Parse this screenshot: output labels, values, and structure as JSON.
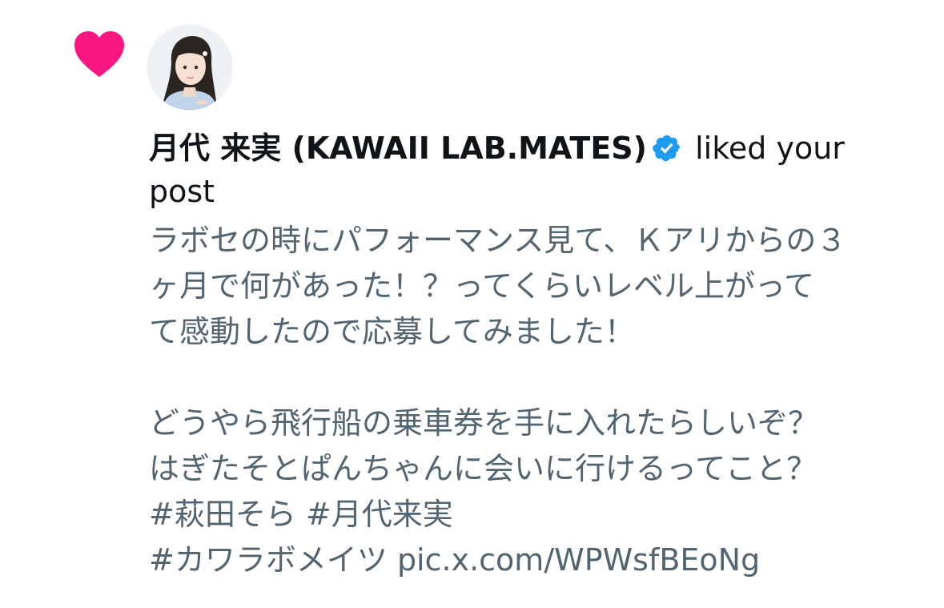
{
  "notification": {
    "type_icon": "heart-icon",
    "accent_color": "#f91880",
    "avatar": {
      "icon": "profile-photo"
    },
    "user_name": "月代 来実 (KAWAII LAB.MATES)",
    "verified_icon": "verified-badge-icon",
    "verified_color": "#1d9bf0",
    "action_text": "liked your",
    "action_text_2": "post",
    "post_lines": [
      "ラボセの時にパフォーマンス見て、Ｋアリからの３",
      "ヶ月で何があった！？ってくらいレベル上がって",
      "て感動したので応募してみました！",
      "",
      "どうやら飛行船の乗車券を手に入れたらしいぞ？",
      "はぎたそとぱんちゃんに会いに行けるってこと？",
      "#萩田そら #月代来実"
    ],
    "post_last_hashtag": "#カワラボメイツ",
    "post_link": "pic.x.com/WPWsfBEoNg"
  }
}
